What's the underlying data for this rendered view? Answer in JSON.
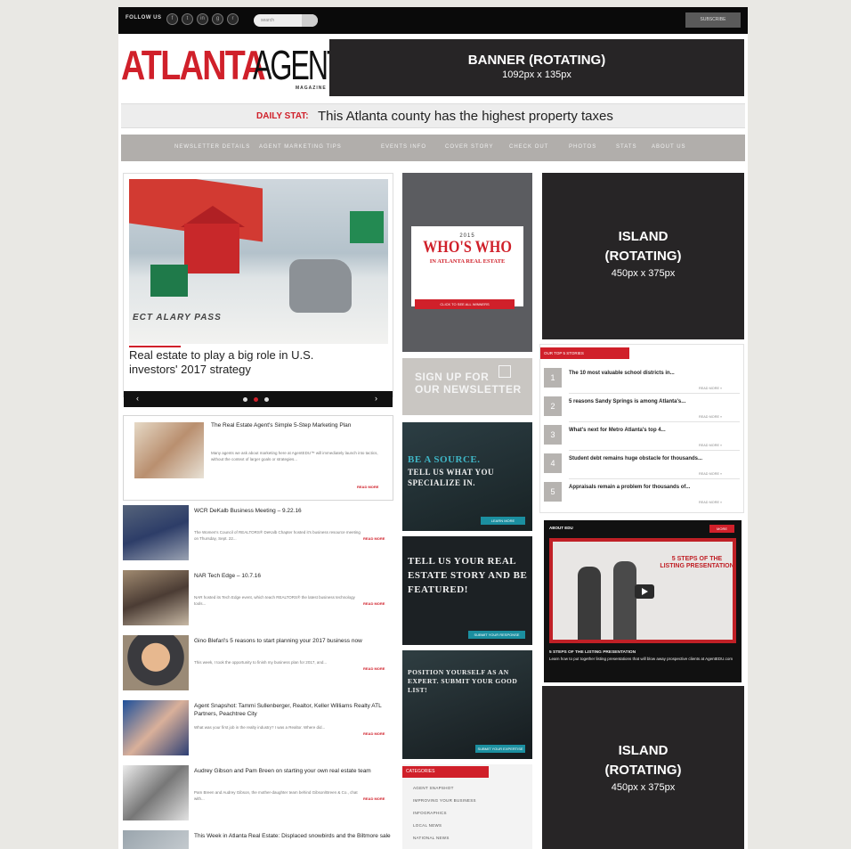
{
  "topbar": {
    "follow_label": "FOLLOW US",
    "search_placeholder": "search",
    "subscribe_label": "SUBSCRIBE"
  },
  "header": {
    "logo_atlanta": "ATLANTA",
    "logo_agent": "AGENT",
    "logo_magazine": "MAGAZINE",
    "banner_title": "BANNER (ROTATING)",
    "banner_size": "1092px x 135px"
  },
  "daily_stat": {
    "label": "DAILY STAT:",
    "text": "This Atlanta county has the highest property taxes"
  },
  "nav": [
    "NEWSLETTER DETAILS",
    "AGENT MARKETING TIPS",
    "EVENTS INFO",
    "COVER STORY",
    "CHECK OUT",
    "PHOTOS",
    "STATS",
    "ABOUT US"
  ],
  "hero": {
    "board_text": "ECT ALARY PASS",
    "title": "Real estate to play a big role in U.S. investors' 2017 strategy",
    "prev": "‹",
    "next": "›"
  },
  "feature": {
    "title": "The Real Estate Agent's Simple 5-Step Marketing Plan",
    "excerpt": "Many agents we ask about marketing here at AgentEDU™ will immediately launch into tactics, without the context of larger goals or strategies...",
    "read_more": "READ MORE"
  },
  "stories": [
    {
      "title": "WCR DeKalb Business Meeting – 9.22.16",
      "excerpt": "The Women's Council of REALTORS® DeKalb Chapter hosted it's business resource meeting on Thursday, Sept. 22...",
      "read_more": "READ MORE"
    },
    {
      "title": "NAR Tech Edge – 10.7.16",
      "excerpt": "NAR hosted its Tech Edge event, which teach REALTORS® the latest business technology tools...",
      "read_more": "READ MORE"
    },
    {
      "title": "Gino Blefari's 5 reasons to start planning your 2017 business now",
      "excerpt": "This week, I took the opportunity to finish my business plan for 2017, and...",
      "read_more": "READ MORE"
    },
    {
      "title": "Agent Snapshot: Tammi Sullenberger, Realtor, Keller Williams Realty ATL Partners, Peachtree City",
      "excerpt": "What was your first job in the realty industry? I was a Realtor. Where did...",
      "read_more": "READ MORE"
    },
    {
      "title": "Audrey Gibson and Pam Breen on starting your own real estate team",
      "excerpt": "Pam Breen and Audrey Gibson, the mother-daughter team behind Gibson/Breen & Co., chat with...",
      "read_more": "READ MORE"
    },
    {
      "title": "This Week in Atlanta Real Estate: Displaced snowbirds and the Biltmore sale",
      "excerpt": "",
      "read_more": ""
    }
  ],
  "middle": {
    "whoswho_year": "2015",
    "whoswho_title": "WHO'S WHO",
    "whoswho_sub": "IN ATLANTA REAL ESTATE",
    "whoswho_btn": "CLICK TO SEE ALL WINNERS",
    "newsletter_line1": "SIGN UP FOR",
    "newsletter_line2": "OUR NEWSLETTER",
    "promo1_hl": "BE A SOURCE.",
    "promo1_text": "TELL US WHAT YOU SPECIALIZE IN.",
    "promo1_btn": "LEARN MORE",
    "promo2_text": "TELL US YOUR REAL ESTATE STORY AND BE FEATURED!",
    "promo2_btn": "SUBMIT YOUR RESPONSE",
    "promo3_text": "POSITION YOURSELF AS AN EXPERT. SUBMIT YOUR GOOD LIST!",
    "promo3_btn": "SUBMIT YOUR EXPERTISE",
    "categories_title": "CATEGORIES",
    "categories": [
      "AGENT SNAPSHOT",
      "IMPROVING YOUR BUSINESS",
      "INFOGRAPHICS",
      "LOCAL NEWS",
      "NATIONAL NEWS"
    ]
  },
  "islands": [
    {
      "line1": "ISLAND",
      "line2": "(ROTATING)",
      "size": "450px x 375px"
    },
    {
      "line1": "ISLAND",
      "line2": "(ROTATING)",
      "size": "450px x 375px"
    }
  ],
  "top5": {
    "title": "OUR TOP 5 STORIES",
    "items": [
      {
        "num": "1",
        "title": "The 10 most valuable school districts in...",
        "read_more": "READ MORE »"
      },
      {
        "num": "2",
        "title": "5 reasons Sandy Springs is among Atlanta's...",
        "read_more": "READ MORE »"
      },
      {
        "num": "3",
        "title": "What's next for Metro Atlanta's top 4...",
        "read_more": "READ MORE »"
      },
      {
        "num": "4",
        "title": "Student debt remains huge obstacle for thousands...",
        "read_more": "READ MORE »"
      },
      {
        "num": "5",
        "title": "Appraisals remain a problem for thousands of...",
        "read_more": "READ MORE »"
      }
    ]
  },
  "video": {
    "head": "ABOUT EDU",
    "badge": "MORE",
    "frame_title": "5 STEPS OF THE LISTING PRESENTATION",
    "caption_title": "5 STEPS OF THE LISTING PRESENTATION",
    "caption_text": "Learn how to put together listing presentations that will blow away prospective clients at AgentEDU.com"
  }
}
